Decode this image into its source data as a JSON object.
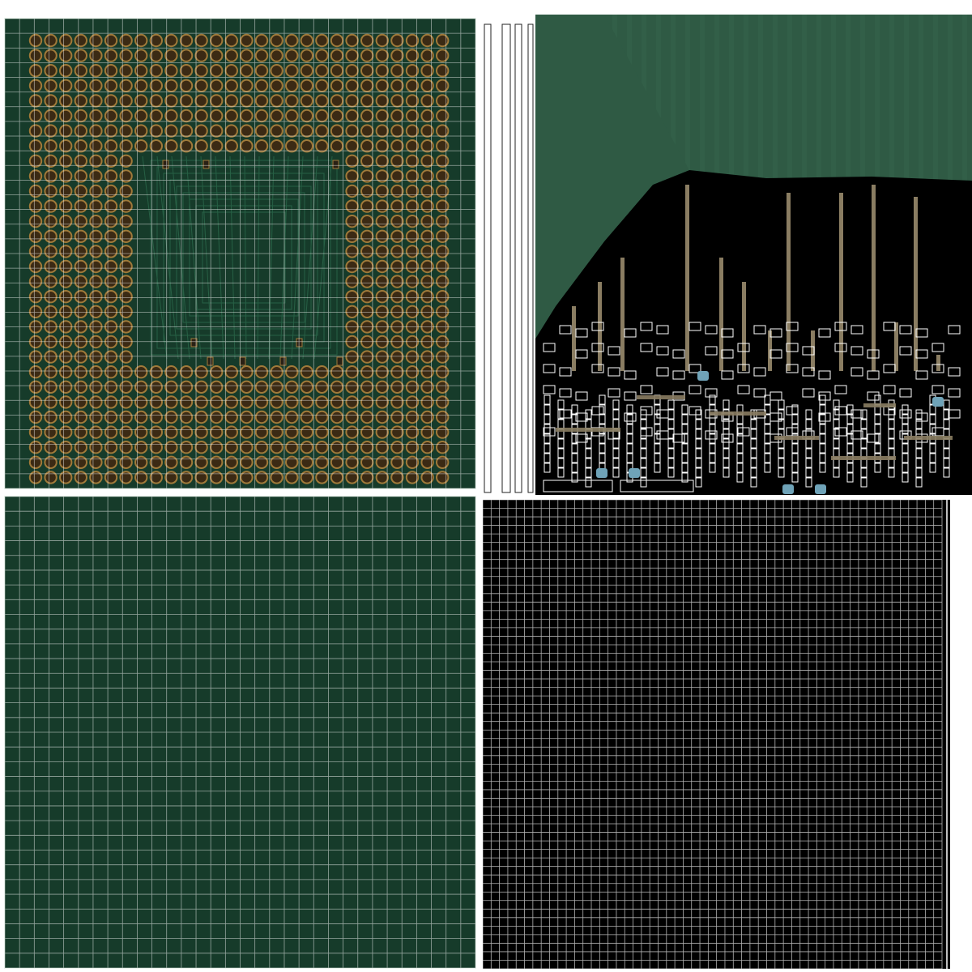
{
  "texture": {
    "colors": {
      "board_green": "#163b2a",
      "board_green_light": "#1e4a34",
      "tab_green": "#2f5a44",
      "pad_gold": "#a07a3a",
      "pad_dark": "#3b2a14",
      "trace": "#8a7d62",
      "grid_line": "#ffffff",
      "cap_blue": "#6fa3b8",
      "black": "#000000"
    },
    "pad_grid": {
      "rows": 30,
      "cols": 28
    },
    "small_grid_cols": 32,
    "dense_grid_cols": 55
  }
}
